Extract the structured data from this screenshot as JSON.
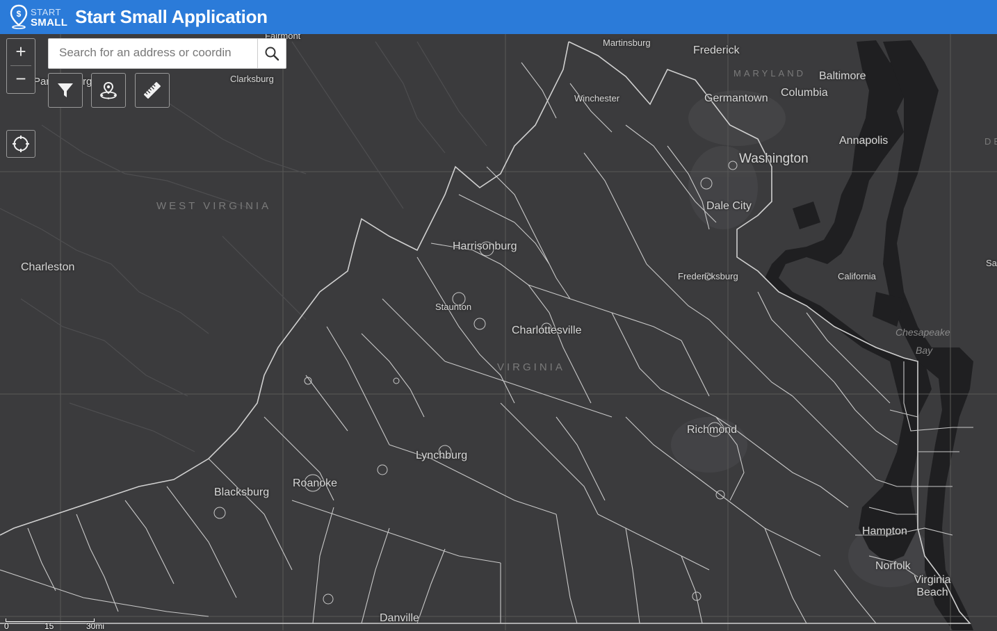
{
  "app": {
    "logo_top": "START",
    "logo_bottom": "SMALL",
    "title": "Start Small Application"
  },
  "search": {
    "placeholder": "Search for an address or coordin",
    "value": ""
  },
  "controls": {
    "zoom_in": "+",
    "zoom_out": "−",
    "tools": [
      {
        "name": "filter",
        "icon": "filter-icon"
      },
      {
        "name": "location-picker",
        "icon": "map-pin-icon"
      },
      {
        "name": "measure",
        "icon": "ruler-icon"
      }
    ],
    "locate_icon": "locate-icon"
  },
  "map": {
    "states": [
      "WEST VIRGINIA",
      "VIRGINIA",
      "MARYLAND"
    ],
    "cities": [
      "Fairmont",
      "Martinsburg",
      "Frederick",
      "Clarksburg",
      "Winchester",
      "Baltimore",
      "Germantown",
      "Columbia",
      "Annapolis",
      "Washington",
      "Dale City",
      "Harrisonburg",
      "Charleston",
      "Fredericksburg",
      "California",
      "Staunton",
      "Charlottesville",
      "Richmond",
      "Lynchburg",
      "Roanoke",
      "Blacksburg",
      "Hampton",
      "Norfolk",
      "Virginia Beach",
      "Danville",
      "Par",
      "rg",
      "Sa",
      "DE"
    ],
    "water": [
      "Chesapeake",
      "Bay"
    ],
    "scale": {
      "zero": "0",
      "mid": "15",
      "end": "30mi"
    }
  },
  "colors": {
    "header": "#2b7bd9",
    "land": "#3b3b3d",
    "water": "#1f1f21",
    "boundary": "#c9c9c9"
  }
}
